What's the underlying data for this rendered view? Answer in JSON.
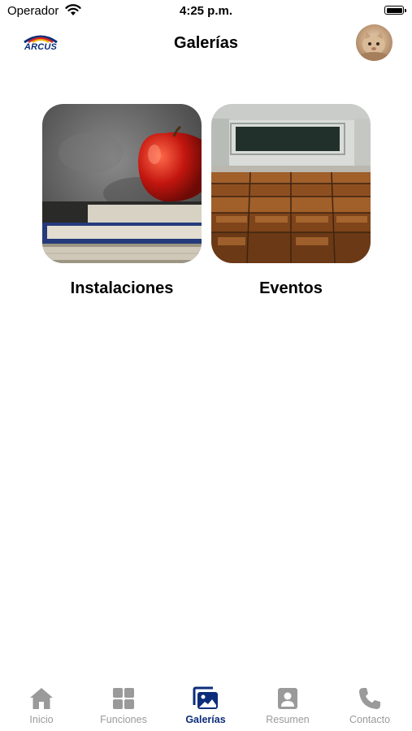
{
  "status_bar": {
    "carrier": "Operador",
    "time": "4:25 p.m."
  },
  "nav": {
    "title": "Galerías",
    "logo_text": "ARCUS"
  },
  "gallery": [
    {
      "label": "Instalaciones"
    },
    {
      "label": "Eventos"
    }
  ],
  "tabs": [
    {
      "label": "Inicio",
      "icon": "home-icon"
    },
    {
      "label": "Funciones",
      "icon": "grid-icon"
    },
    {
      "label": "Galerías",
      "icon": "gallery-icon",
      "active": true
    },
    {
      "label": "Resumen",
      "icon": "person-icon"
    },
    {
      "label": "Contacto",
      "icon": "phone-icon"
    }
  ],
  "colors": {
    "accent": "#0d2d7a",
    "inactive": "#9a9a9a"
  }
}
